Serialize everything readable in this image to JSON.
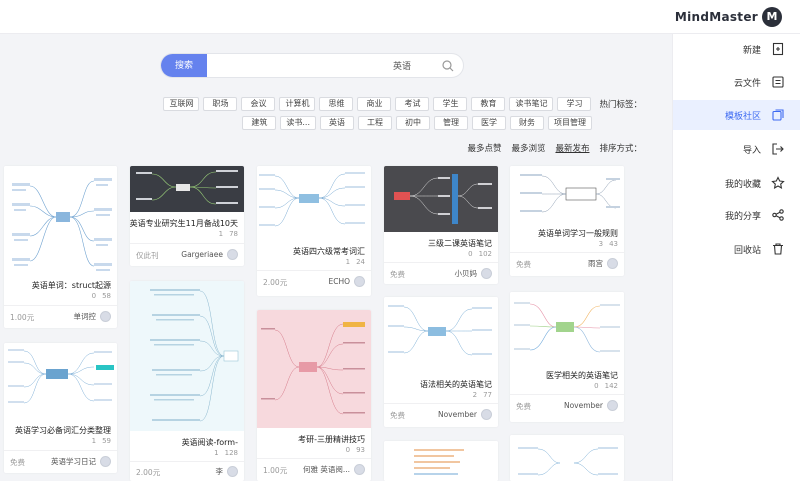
{
  "brand": {
    "logo_letter": "M",
    "name": "MindMaster"
  },
  "sidebar": {
    "items": [
      {
        "label": "新建",
        "icon": "new-file-icon"
      },
      {
        "label": "云文件",
        "icon": "cloud-file-icon"
      },
      {
        "label": "模板社区",
        "icon": "template-community-icon",
        "active": true
      },
      {
        "label": "导入",
        "icon": "import-icon"
      },
      {
        "label": "我的收藏",
        "icon": "star-icon"
      },
      {
        "label": "我的分享",
        "icon": "share-icon"
      },
      {
        "label": "回收站",
        "icon": "trash-icon"
      }
    ]
  },
  "search": {
    "button_label": "搜索",
    "value": "英语",
    "placeholder": ""
  },
  "hot_tags": {
    "label": "热门标签：",
    "row1": [
      "学习",
      "读书笔记",
      "教育",
      "学生",
      "考试",
      "商业",
      "思维",
      "计算机",
      "会议",
      "职场",
      "互联网"
    ],
    "row2": [
      "项目管理",
      "财务",
      "医学",
      "管理",
      "初中",
      "工程",
      "英语",
      "读书...",
      "建筑"
    ]
  },
  "sort": {
    "label": "排序方式：",
    "options": [
      {
        "label": "最新发布",
        "active": true
      },
      {
        "label": "最多浏览"
      },
      {
        "label": "最多点赞"
      }
    ]
  },
  "cards": [
    {
      "title": "英语单词：struct起源",
      "views": "58",
      "likes": "0",
      "author": "单词控",
      "price": "1.00元"
    },
    {
      "title": "英语学习必备词汇分类整理",
      "views": "59",
      "likes": "1",
      "author": "英语学习日记",
      "price": "免费"
    },
    {
      "title": "英语专业研究生11月备战10天",
      "views": "78",
      "likes": "1",
      "author": "Gargeriaee",
      "price": "仅此刊"
    },
    {
      "title": "英语阅读-form-",
      "views": "128",
      "likes": "1",
      "author": "李",
      "price": "2.00元"
    },
    {
      "title": "英语四六级常考词汇",
      "views": "24",
      "likes": "1",
      "author": "ECHO",
      "price": "2.00元"
    },
    {
      "title": "考研-三册精讲技巧",
      "views": "93",
      "likes": "0",
      "author": "何雅 英语阅...",
      "price": "1.00元"
    },
    {
      "title": "三级二课英语笔记",
      "views": "102",
      "likes": "0",
      "author": "小贝妈",
      "price": "免费"
    },
    {
      "title": "语法相关的英语笔记",
      "views": "77",
      "likes": "2",
      "author": "November",
      "price": "免费"
    },
    {
      "title": "英语单词学习一般规则",
      "views": "43",
      "likes": "3",
      "author": "雨宫",
      "price": "免费"
    },
    {
      "title": "医学相关的英语笔记",
      "views": "142",
      "likes": "0",
      "author": "November",
      "price": "免费"
    }
  ],
  "colors": {
    "accent": "#6582ee",
    "active_bg": "#eaf0ff",
    "active_fg": "#3d6af2"
  }
}
